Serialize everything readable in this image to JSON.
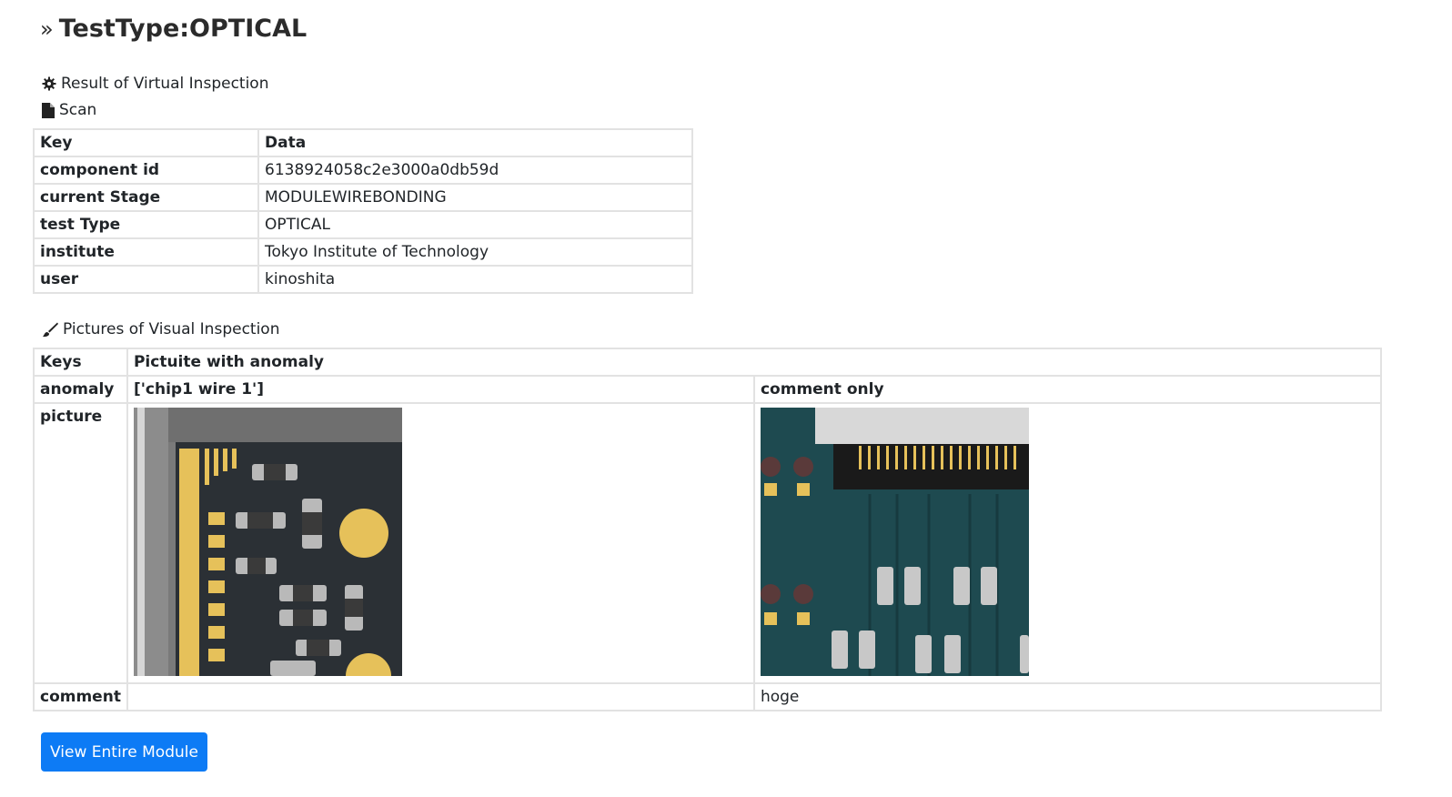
{
  "title": "TestType:OPTICAL",
  "sections": {
    "result": "Result of Virtual Inspection",
    "scan": "Scan",
    "pictures": "Pictures of Visual Inspection"
  },
  "scan_table": {
    "headers": [
      "Key",
      "Data"
    ],
    "rows": [
      {
        "key": "component id",
        "value": "6138924058c2e3000a0db59d"
      },
      {
        "key": "current Stage",
        "value": "MODULEWIREBONDING"
      },
      {
        "key": "test Type",
        "value": "OPTICAL"
      },
      {
        "key": "institute",
        "value": "Tokyo Institute of Technology"
      },
      {
        "key": "user",
        "value": "kinoshita"
      }
    ]
  },
  "pictures_table": {
    "headers": [
      "Keys",
      "Pictuite with anomaly"
    ],
    "row_labels": {
      "anomaly": "anomaly",
      "picture": "picture",
      "comment": "comment"
    },
    "columns": [
      {
        "anomaly": "['chip1 wire 1']",
        "comment": ""
      },
      {
        "anomaly": "comment only",
        "comment": "hoge"
      }
    ]
  },
  "button_label": "View Entire Module",
  "colors": {
    "button": "#0d7bf5",
    "border": "#e2e2e2",
    "pcb_dark": "#2b3035",
    "pcb_teal": "#1e4a50",
    "gold": "#e6c15a"
  }
}
